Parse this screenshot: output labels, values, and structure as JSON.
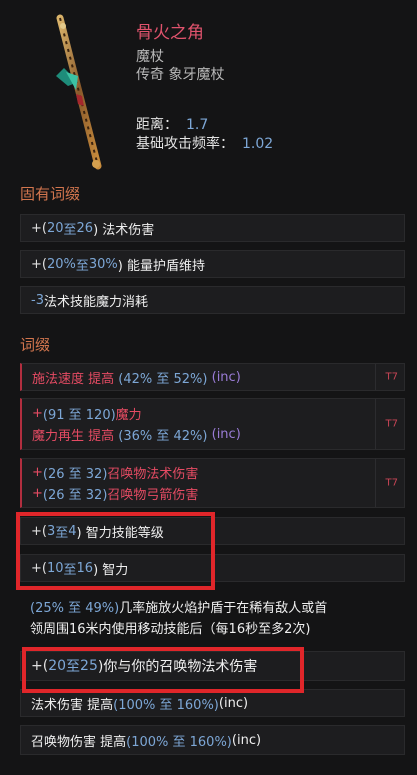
{
  "item": {
    "name": "骨火之角",
    "type": "魔杖",
    "rarity_line": "传奇 象牙魔杖",
    "stats": [
      {
        "label": "距离：",
        "value": "1.7"
      },
      {
        "label": "基础攻击频率：",
        "value": "1.02"
      }
    ]
  },
  "implicit": {
    "title": "固有词缀",
    "rows": [
      {
        "prefix": "+(",
        "min": "20",
        "sep": " 至 ",
        "max": "26",
        "suffix": ") 法术伤害"
      },
      {
        "prefix": "+(",
        "min": "20%",
        "sep": " 至 ",
        "max": "30%",
        "suffix": ") 能量护盾维持"
      },
      {
        "prefix": "",
        "min": "-3",
        "sep": "",
        "max": "",
        "suffix": " 法术技能魔力消耗"
      }
    ]
  },
  "affixes": {
    "title": "词缀",
    "tiered": [
      {
        "tier": "T7",
        "lines": [
          {
            "text_red": "施法速度 提高",
            "range": "(42% 至 52%)",
            "inc": "(inc)"
          }
        ]
      },
      {
        "tier": "T7",
        "lines": [
          {
            "plus": "+",
            "range": "(91 至 120)",
            "text_red": " 魔力"
          },
          {
            "text_red": "魔力再生 提高",
            "range": "(36% 至 42%)",
            "inc": "(inc)"
          }
        ]
      },
      {
        "tier": "T7",
        "lines": [
          {
            "plus": "+",
            "range": "(26 至 32)",
            "text_red": " 召唤物法术伤害"
          },
          {
            "plus": "+",
            "range": "(26 至 32)",
            "text_red": " 召唤物弓箭伤害"
          }
        ]
      }
    ],
    "rows": [
      {
        "pre": "+(",
        "a": "3",
        "mid": " 至 ",
        "b": "4",
        "post": ") 智力技能等级"
      },
      {
        "pre": "+(",
        "a": "10",
        "mid": " 至 ",
        "b": "16",
        "post": ") 智力"
      }
    ],
    "multi_line_row": {
      "line1_range": "(25% 至 49%)",
      "line1_text": " 几率施放火焰护盾于在稀有敌人或首",
      "line2_text": "领周围16米内使用移动技能后（每16秒至多2次)"
    },
    "row_minion": {
      "pre": "+(",
      "a": "20",
      "mid": " 至 ",
      "b": "25",
      "post": ")你与你的召唤物法术伤害"
    },
    "row_spell_inc": {
      "text": "法术伤害 提高 ",
      "range": "(100% 至 160%)",
      "inc": " (inc)"
    },
    "row_minion_inc": {
      "text": "召唤物伤害 提高 ",
      "range": "(100% 至 160%)",
      "inc": " (inc)"
    }
  },
  "colors": {
    "name": "#e0536d",
    "section_title": "#d3764e",
    "number_blue": "#7da7d6",
    "affix_red": "#e54b63",
    "highlight_box": "#e0262a"
  }
}
